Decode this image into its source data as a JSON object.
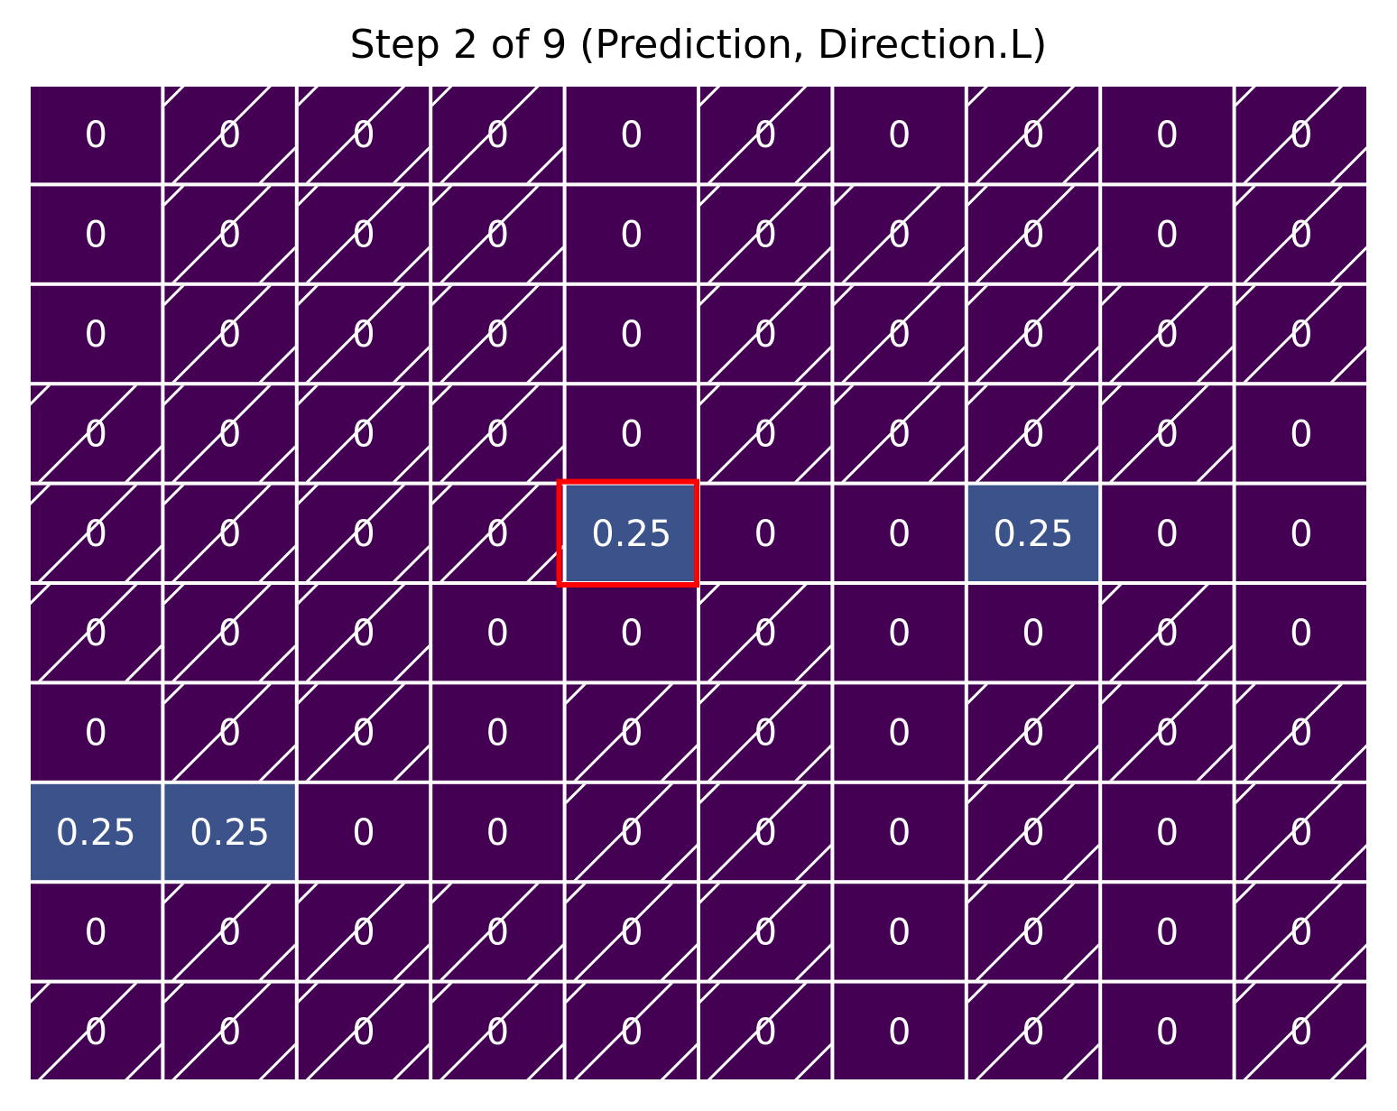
{
  "chart_data": {
    "type": "heatmap",
    "title": "Step 2 of 9 (Prediction, Direction.L)",
    "rows": 10,
    "cols": 10,
    "values": [
      [
        0,
        0,
        0,
        0,
        0,
        0,
        0,
        0,
        0,
        0
      ],
      [
        0,
        0,
        0,
        0,
        0,
        0,
        0,
        0,
        0,
        0
      ],
      [
        0,
        0,
        0,
        0,
        0,
        0,
        0,
        0,
        0,
        0
      ],
      [
        0,
        0,
        0,
        0,
        0,
        0,
        0,
        0,
        0,
        0
      ],
      [
        0,
        0,
        0,
        0,
        0.25,
        0,
        0,
        0.25,
        0,
        0
      ],
      [
        0,
        0,
        0,
        0,
        0,
        0,
        0,
        0,
        0,
        0
      ],
      [
        0,
        0,
        0,
        0,
        0,
        0,
        0,
        0,
        0,
        0
      ],
      [
        0.25,
        0.25,
        0,
        0,
        0,
        0,
        0,
        0,
        0,
        0
      ],
      [
        0,
        0,
        0,
        0,
        0,
        0,
        0,
        0,
        0,
        0
      ],
      [
        0,
        0,
        0,
        0,
        0,
        0,
        0,
        0,
        0,
        0
      ]
    ],
    "labels": [
      [
        "0",
        "0",
        "0",
        "0",
        "0",
        "0",
        "0",
        "0",
        "0",
        "0"
      ],
      [
        "0",
        "0",
        "0",
        "0",
        "0",
        "0",
        "0",
        "0",
        "0",
        "0"
      ],
      [
        "0",
        "0",
        "0",
        "0",
        "0",
        "0",
        "0",
        "0",
        "0",
        "0"
      ],
      [
        "0",
        "0",
        "0",
        "0",
        "0",
        "0",
        "0",
        "0",
        "0",
        "0"
      ],
      [
        "0",
        "0",
        "0",
        "0",
        "0.25",
        "0",
        "0",
        "0.25",
        "0",
        "0"
      ],
      [
        "0",
        "0",
        "0",
        "0",
        "0",
        "0",
        "0",
        "0",
        "0",
        "0"
      ],
      [
        "0",
        "0",
        "0",
        "0",
        "0",
        "0",
        "0",
        "0",
        "0",
        "0"
      ],
      [
        "0.25",
        "0.25",
        "0",
        "0",
        "0",
        "0",
        "0",
        "0",
        "0",
        "0"
      ],
      [
        "0",
        "0",
        "0",
        "0",
        "0",
        "0",
        "0",
        "0",
        "0",
        "0"
      ],
      [
        "0",
        "0",
        "0",
        "0",
        "0",
        "0",
        "0",
        "0",
        "0",
        "0"
      ]
    ],
    "hatched": [
      [
        0,
        1,
        1,
        1,
        0,
        1,
        0,
        1,
        0,
        1
      ],
      [
        0,
        1,
        1,
        1,
        0,
        1,
        1,
        1,
        0,
        1
      ],
      [
        0,
        1,
        1,
        1,
        0,
        1,
        1,
        1,
        1,
        1
      ],
      [
        1,
        1,
        1,
        1,
        0,
        1,
        1,
        1,
        1,
        0
      ],
      [
        1,
        1,
        1,
        1,
        0,
        0,
        0,
        0,
        0,
        0
      ],
      [
        1,
        1,
        1,
        0,
        0,
        1,
        0,
        0,
        1,
        0
      ],
      [
        0,
        1,
        1,
        0,
        1,
        1,
        0,
        1,
        1,
        1
      ],
      [
        0,
        0,
        0,
        0,
        1,
        1,
        0,
        1,
        0,
        1
      ],
      [
        0,
        1,
        1,
        1,
        1,
        1,
        0,
        1,
        0,
        1
      ],
      [
        1,
        1,
        1,
        1,
        1,
        1,
        0,
        1,
        0,
        1
      ]
    ],
    "highlight": {
      "row": 4,
      "col": 4
    },
    "colors": {
      "low": "#440154",
      "high": "#3b528b",
      "grid": "#ffffff",
      "hatch": "#ffffff",
      "highlight": "#ff0000"
    },
    "grid": true,
    "legend": "none"
  }
}
